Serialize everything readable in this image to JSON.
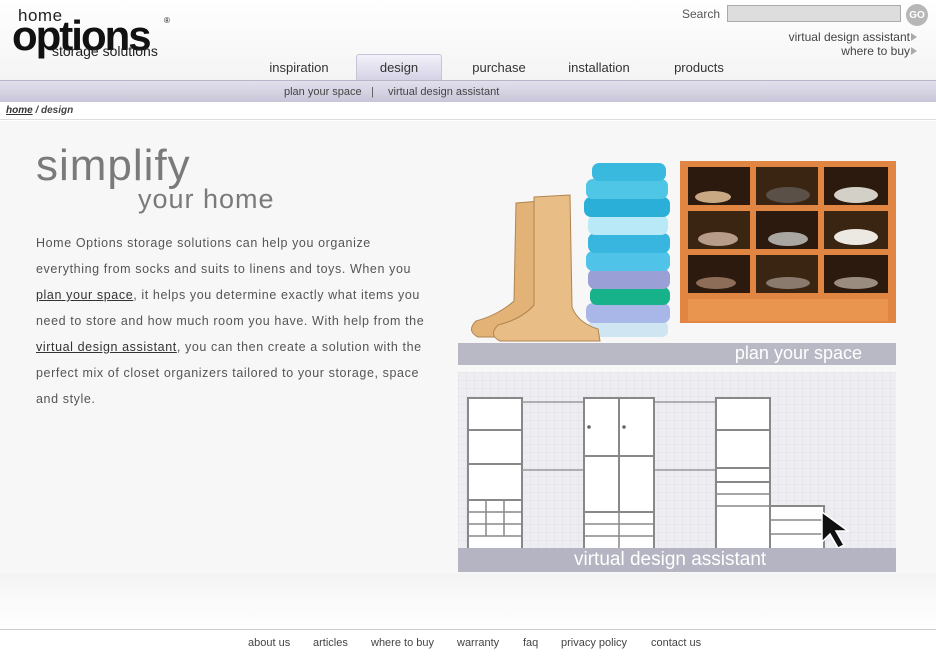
{
  "logo": {
    "top": "home",
    "main": "options",
    "reg": "®",
    "sub": "storage solutions"
  },
  "search": {
    "label": "Search",
    "value": "",
    "placeholder": "",
    "go": "GO"
  },
  "util_links": {
    "vda": "virtual design assistant",
    "where": "where to buy"
  },
  "tabs": [
    {
      "label": "inspiration"
    },
    {
      "label": "design"
    },
    {
      "label": "purchase"
    },
    {
      "label": "installation"
    },
    {
      "label": "products"
    }
  ],
  "subnav": {
    "plan": "plan your space",
    "sep": "|",
    "vda": "virtual design assistant"
  },
  "breadcrumb": {
    "home": "home",
    "sep": " / ",
    "current": "design"
  },
  "main": {
    "title1": "simplify",
    "title2": "your home",
    "p1": "Home Options storage solutions can help you organize everything from socks and suits to linens and toys. When you ",
    "link1": "plan your space",
    "p2": ", it helps you determine exactly what items you need to store and how much room you have. With help from the ",
    "link2": "virtual design assistant",
    "p3": ", you can then create a solution with the perfect mix of closet organizers tailored to your storage, space and style."
  },
  "images": {
    "plan_caption": "plan your space",
    "vda_caption": "virtual design assistant"
  },
  "footer": {
    "links": [
      "about us",
      "articles",
      "where to buy",
      "warranty",
      "faq",
      "privacy policy",
      "contact us"
    ]
  }
}
